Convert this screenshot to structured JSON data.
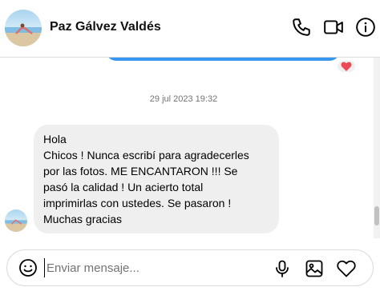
{
  "header": {
    "contact_name": "Paz Gálvez Valdés",
    "icons": [
      "phone-icon",
      "video-camera-icon",
      "info-icon"
    ]
  },
  "conversation": {
    "timestamp": "29 jul 2023 19:32",
    "reaction": "heart",
    "message_lines": [
      "Hola",
      "Chicos ! Nunca escribí para agradecerles",
      "por las fotos. ME ENCANTARON !!!  Se",
      "pasó la calidad ! Un acierto total",
      "imprimirlas con ustedes. Se pasaron !",
      "Muchas gracias"
    ]
  },
  "composer": {
    "placeholder": "Enviar mensaje...",
    "icons": [
      "emoji-icon",
      "microphone-icon",
      "image-icon",
      "heart-icon"
    ]
  },
  "colors": {
    "accent": "#3797f0",
    "bubble_gray": "#efefef",
    "reaction_red": "#ed4956"
  }
}
